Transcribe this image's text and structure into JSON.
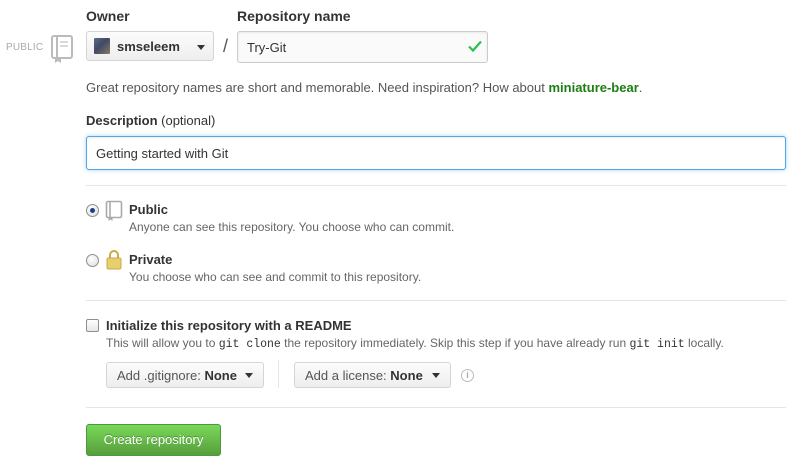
{
  "owner": {
    "label": "Owner",
    "username": "smseleem"
  },
  "repository": {
    "label": "Repository name",
    "separator": "/",
    "value": "Try-Git"
  },
  "visibility_tag": "PUBLIC",
  "hint": {
    "text": "Great repository names are short and memorable. Need inspiration? How about ",
    "suggestion": "miniature-bear",
    "end": "."
  },
  "description": {
    "label": "Description",
    "optional": "(optional)",
    "value": "Getting started with Git"
  },
  "visibility": {
    "public": {
      "title": "Public",
      "subtitle": "Anyone can see this repository. You choose who can commit.",
      "selected": true
    },
    "private": {
      "title": "Private",
      "subtitle": "You choose who can see and commit to this repository.",
      "selected": false
    }
  },
  "readme": {
    "title": "Initialize this repository with a README",
    "desc_1": "This will allow you to ",
    "code_1": "git clone",
    "desc_2": " the repository immediately. Skip this step if you have already run ",
    "code_2": "git init",
    "desc_3": " locally.",
    "checked": false
  },
  "gitignore": {
    "label": "Add .gitignore:",
    "value": "None"
  },
  "license": {
    "label": "Add a license:",
    "value": "None"
  },
  "info_icon": "i",
  "create_button": "Create repository",
  "colors": {
    "accent_green": "#569e3d",
    "suggestion_green": "#1e7d12",
    "focus_blue": "#51a7e8",
    "check_green": "#2cbe4e"
  }
}
